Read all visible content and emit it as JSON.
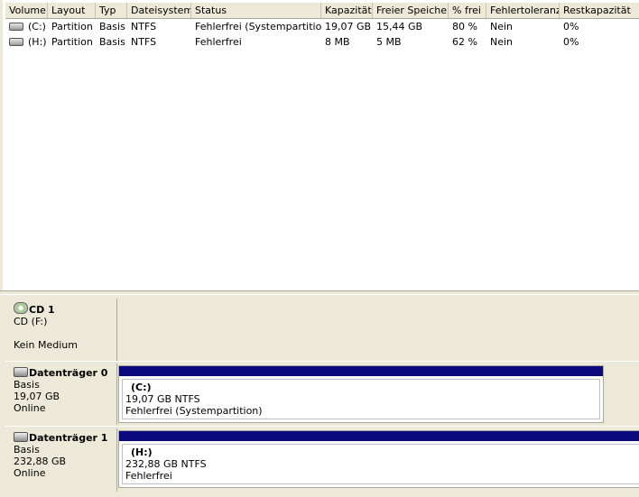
{
  "columns": [
    "Volume",
    "Layout",
    "Typ",
    "Dateisystem",
    "Status",
    "Kapazität",
    "Freier Speicher",
    "% frei",
    "Fehlertoleranz",
    "Restkapazität"
  ],
  "volumes": [
    {
      "volume": "(C:)",
      "layout": "Partition",
      "typ": "Basis",
      "fs": "NTFS",
      "status": "Fehlerfrei (Systempartition)",
      "kap": "19,07 GB",
      "frei": "15,44 GB",
      "pct": "80 %",
      "ft": "Nein",
      "rest": "0%"
    },
    {
      "volume": "(H:)",
      "layout": "Partition",
      "typ": "Basis",
      "fs": "NTFS",
      "status": "Fehlerfrei",
      "kap": "8 MB",
      "frei": "5 MB",
      "pct": "62 %",
      "ft": "Nein",
      "rest": "0%"
    }
  ],
  "disks": [
    {
      "name": "CD 1",
      "line1": "CD (F:)",
      "line2": "",
      "line3": "Kein Medium",
      "icon": "cd-drive-icon"
    },
    {
      "name": "Datenträger 0",
      "line1": "Basis",
      "line2": "19,07 GB",
      "line3": "Online",
      "icon": "hard-disk-icon",
      "partition": {
        "title": "(C:)",
        "size": "19,07 GB NTFS",
        "status": "Fehlerfrei (Systempartition)"
      }
    },
    {
      "name": "Datenträger 1",
      "line1": "Basis",
      "line2": "232,88 GB",
      "line3": "Online",
      "icon": "hard-disk-icon",
      "partition": {
        "title": "(H:)",
        "size": "232,88 GB NTFS",
        "status": "Fehlerfrei"
      }
    }
  ],
  "colors": {
    "partition_bar": "#0a0a7e",
    "panel": "#ece9d8"
  }
}
